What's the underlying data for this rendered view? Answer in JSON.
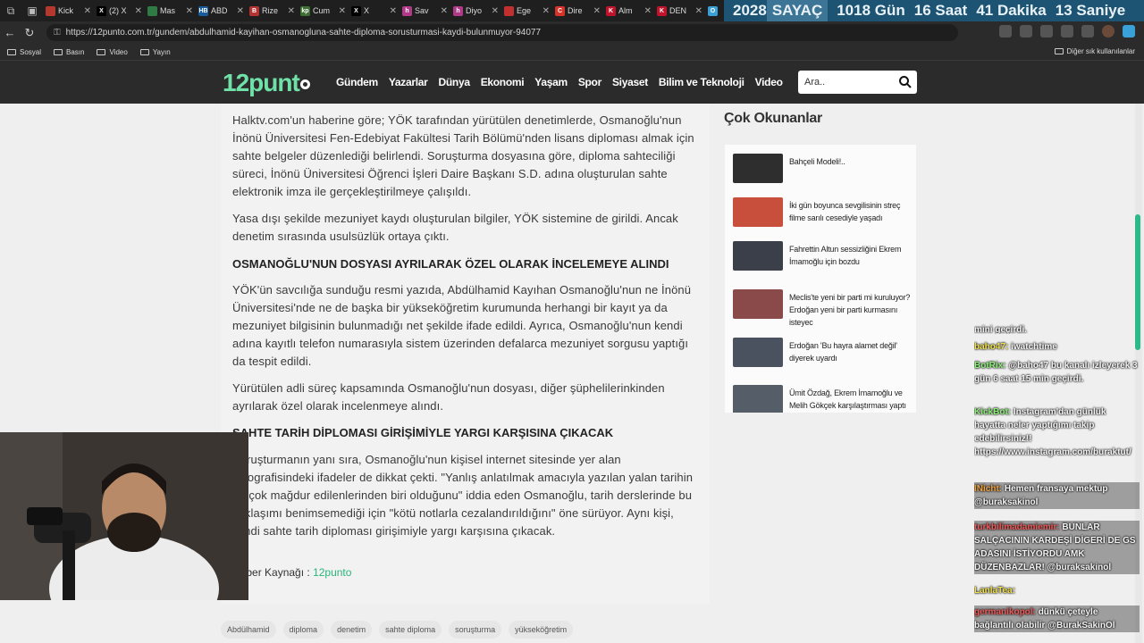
{
  "browser": {
    "tabs": [
      {
        "title": "Kick",
        "color": "#b5382f",
        "letter": ""
      },
      {
        "title": "(2) X",
        "color": "#000000",
        "letter": "X"
      },
      {
        "title": "Mas",
        "color": "#2f7a45",
        "letter": ""
      },
      {
        "title": "ABD",
        "color": "#1a5b9c",
        "letter": "HB"
      },
      {
        "title": "Rize",
        "color": "#b33333",
        "letter": "B"
      },
      {
        "title": "Cum",
        "color": "#3f6f34",
        "letter": "kp"
      },
      {
        "title": "X",
        "color": "#000000",
        "letter": "X"
      },
      {
        "title": "Sav",
        "color": "#b13a88",
        "letter": "h"
      },
      {
        "title": "Diyo",
        "color": "#b13a88",
        "letter": "h"
      },
      {
        "title": "Ege",
        "color": "#c12f2f",
        "letter": ""
      },
      {
        "title": "Dire",
        "color": "#d6342a",
        "letter": "C"
      },
      {
        "title": "Alm",
        "color": "#c1142c",
        "letter": "K"
      },
      {
        "title": "DEN",
        "color": "#c1142c",
        "letter": "K"
      },
      {
        "title": "",
        "color": "#3aa0d8",
        "letter": "O"
      }
    ],
    "counter": {
      "year": "2028",
      "label": "SAYAÇ",
      "days": "1018 Gün",
      "hours": "16 Saat",
      "minutes": "41 Dakika",
      "seconds": "13 Saniye"
    },
    "url": "https://12punto.com.tr/gundem/abdulhamid-kayihan-osmanogluna-sahte-diploma-sorusturmasi-kaydi-bulunmuyor-94077",
    "bookmarks": [
      "Sosyal",
      "Basın",
      "Video",
      "Yayın"
    ],
    "other_bookmarks": "Diğer sık kullanılanlar"
  },
  "site": {
    "logo_number": "12",
    "logo_word": "punt",
    "nav": [
      "Gündem",
      "Yazarlar",
      "Dünya",
      "Ekonomi",
      "Yaşam",
      "Spor",
      "Siyaset",
      "Bilim ve Teknoloji",
      "Video"
    ],
    "search_placeholder": "Ara.."
  },
  "article": {
    "p1": "Halktv.com'un haberine göre; YÖK tarafından yürütülen denetimlerde, Osmanoğlu'nun İnönü Üniversitesi Fen-Edebiyat Fakültesi Tarih Bölümü'nden lisans diploması almak için sahte belgeler düzenlediği belirlendi. Soruşturma dosyasına göre, diploma sahteciliği süreci, İnönü Üniversitesi Öğrenci İşleri Daire Başkanı S.D. adına oluşturulan sahte elektronik imza ile gerçekleştirilmeye çalışıldı.",
    "p2": "Yasa dışı şekilde mezuniyet kaydı oluşturulan bilgiler, YÖK sistemine de girildi. Ancak denetim sırasında usulsüzlük ortaya çıktı.",
    "h1": "OSMANOĞLU'NUN DOSYASI AYRILARAK ÖZEL OLARAK İNCELEMEYE ALINDI",
    "p3": "YÖK'ün savcılığa sunduğu resmi yazıda, Abdülhamid Kayıhan Osmanoğlu'nun ne İnönü Üniversitesi'nde ne de başka bir yükseköğretim kurumunda herhangi bir kayıt ya da mezuniyet bilgisinin bulunmadığı net şekilde ifade edildi. Ayrıca, Osmanoğlu'nun kendi adına kayıtlı telefon numarasıyla sistem üzerinden defalarca mezuniyet sorgusu yaptığı da tespit edildi.",
    "p4": "Yürütülen adli süreç kapsamında Osmanoğlu'nun dosyası, diğer şüphelilerinkinden ayrılarak özel olarak incelenmeye alındı.",
    "h2": "SAHTE TARİH DİPLOMASI GİRİŞİMİYLE YARGI KARŞISINA ÇIKACAK",
    "p5": "Soruşturmanın yanı sıra, Osmanoğlu'nun kişisel internet sitesinde yer alan biyografisindeki ifadeler de dikkat çekti. \"Yanlış anlatılmak amacıyla yazılan yalan tarihin en çok mağdur edilenlerinden biri olduğunu\" iddia eden Osmanoğlu, tarih derslerinde bu yaklaşımı benimsemediği için \"kötü notlarla cezalandırıldığını\" öne sürüyor. Aynı kişi, şimdi sahte tarih diploması girişimiyle yargı karşısına çıkacak.",
    "source_label": "Haber Kaynağı :",
    "source_link": "12punto",
    "tags": [
      "Abdülhamid",
      "diploma",
      "denetim",
      "sahte diploma",
      "soruşturma",
      "yükseköğretim"
    ]
  },
  "sidebar": {
    "title": "Çok Okunanlar",
    "items": [
      {
        "title": "Bahçeli Modeli!..",
        "thumb": "#2e2e2e"
      },
      {
        "title": "İki gün boyunca sevgilisinin streç filme sarılı cesediyle yaşadı",
        "thumb": "#c94f3d"
      },
      {
        "title": "Fahrettin Altun sessizliğini Ekrem İmamoğlu için bozdu",
        "thumb": "#3b3f4a"
      },
      {
        "title": "Meclis'te yeni bir parti mi kuruluyor? Erdoğan yeni bir parti kurmasını isteyec",
        "thumb": "#8a4a4a"
      },
      {
        "title": "Erdoğan 'Bu hayra alamet değil' diyerek uyardı",
        "thumb": "#4a5260"
      },
      {
        "title": "Ümit Özdağ, Ekrem İmamoğlu ve Melih Gökçek karşılaştırması yaptı",
        "thumb": "#555d68"
      }
    ]
  },
  "chat": [
    {
      "user": "",
      "text": "mini geçirdi.",
      "cls": "",
      "hl": false
    },
    {
      "user": "baho47:",
      "text": "iwatchtime",
      "cls": "",
      "hl": false
    },
    {
      "user": "BotRix:",
      "text": "@baho47 bu kanalı izleyerek 3 gün 6 saat 15 min geçirdi.",
      "cls": "g",
      "hl": false
    },
    {
      "user": "KickBot:",
      "text": "Instagram'dan günlük hayatta neler yaptığımı takip edebilirsiniz!! https://www.instagram.com/buraktut/",
      "cls": "g",
      "hl": false
    },
    {
      "user": "INicht:",
      "text": "Hemen fransaya mektup @buraksakinol",
      "cls": "o",
      "hl": true
    },
    {
      "user": "turkbilimadamiemir:",
      "text": "BUNLAR SALÇACININ KARDEŞİ DİGERİ DE GS ADASINI İSTİYORDU AMK DÜZENBAZLAR! @buraksakinol",
      "cls": "r",
      "hl": true
    },
    {
      "user": "LanlaTea:",
      "text": "",
      "cls": "",
      "hl": false
    },
    {
      "user": "germanikopol:",
      "text": "dünkü çeteyle bağlantılı olabilir @BurakSakinOl",
      "cls": "r",
      "hl": true
    }
  ]
}
